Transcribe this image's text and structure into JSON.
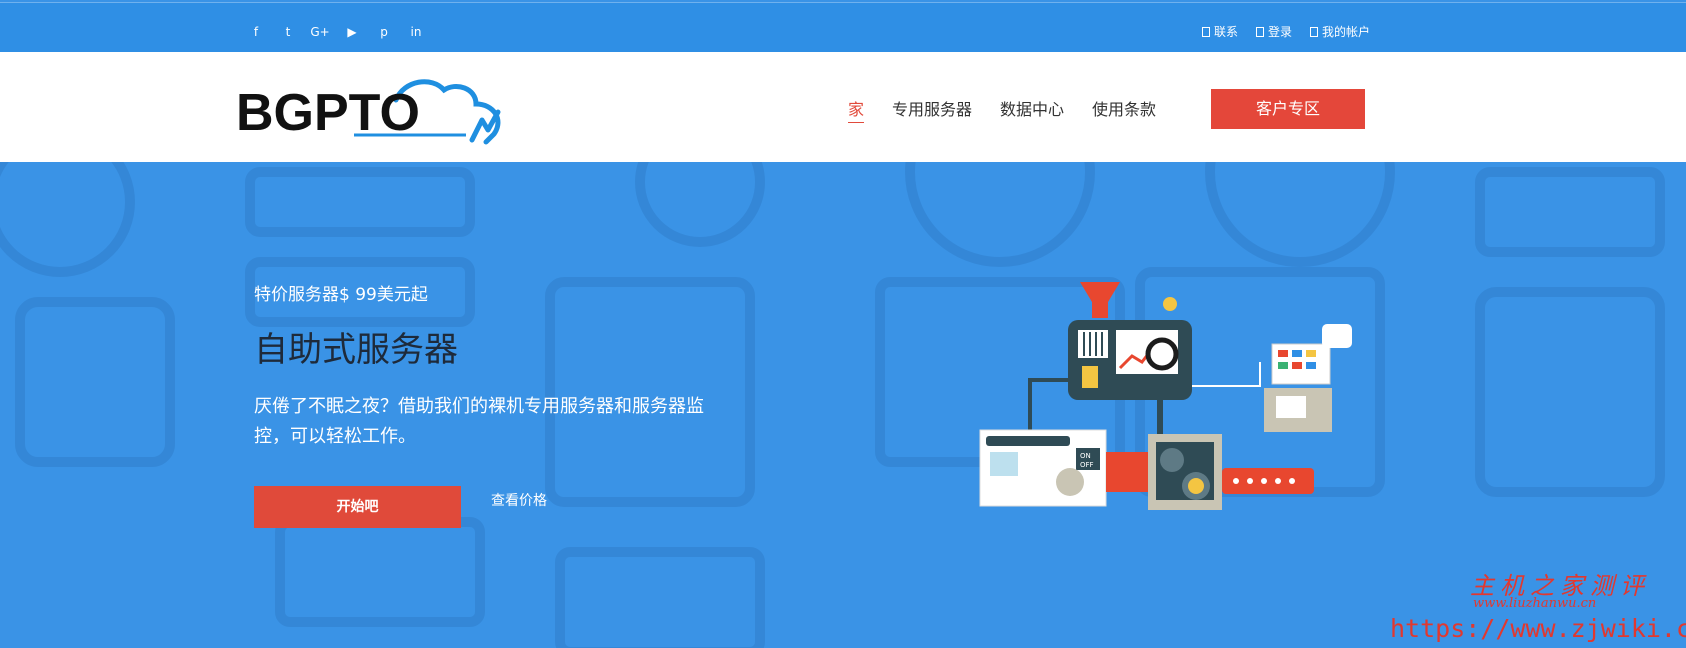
{
  "topbar": {
    "social": [
      {
        "icon": "facebook-icon",
        "glyph": "f"
      },
      {
        "icon": "twitter-icon",
        "glyph": "t"
      },
      {
        "icon": "google-plus-icon",
        "glyph": "G+"
      },
      {
        "icon": "youtube-icon",
        "glyph": "▶"
      },
      {
        "icon": "pinterest-icon",
        "glyph": "p"
      },
      {
        "icon": "linkedin-icon",
        "glyph": "in"
      }
    ],
    "links": {
      "contact": "联系",
      "login": "登录",
      "account": "我的帐户"
    }
  },
  "header": {
    "logo_text": "BGPTO",
    "nav": {
      "home": "家",
      "dedicated": "专用服务器",
      "datacenter": "数据中心",
      "terms": "使用条款"
    },
    "client_area": "客户专区"
  },
  "hero": {
    "tagline": "特价服务器$ 99美元起",
    "headline": "自助式服务器",
    "description": "厌倦了不眠之夜？借助我们的裸机专用服务器和服务器监控，可以轻松工作。",
    "start_button": "开始吧",
    "price_link": "查看价格",
    "switch_on": "ON",
    "switch_off": "OFF"
  },
  "watermark": {
    "chinese": "主机之家测评",
    "sub": "www.liuzhanwu.cn",
    "url": "https://www.zjwiki.com"
  },
  "colors": {
    "brand_blue": "#2f8fe5",
    "accent_red": "#e4473a",
    "hero_blue": "#3a93e6"
  }
}
